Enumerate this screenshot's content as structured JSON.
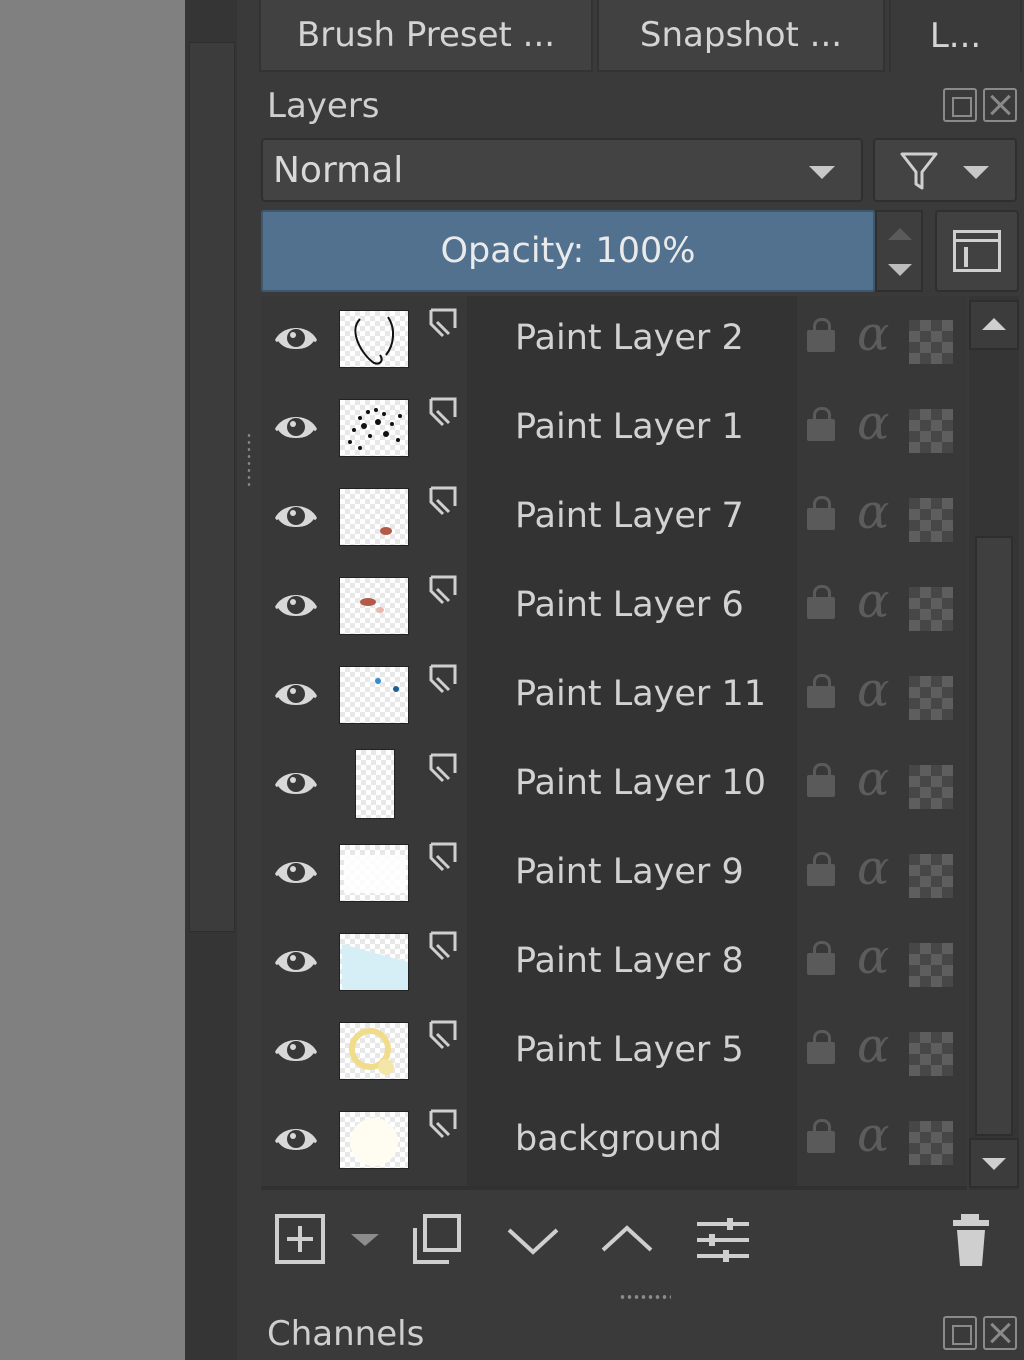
{
  "tabs": [
    {
      "label": "Brush Preset ..."
    },
    {
      "label": "Snapshot ..."
    },
    {
      "label": "L..."
    }
  ],
  "layers_docker": {
    "title": "Layers",
    "blend_mode": "Normal",
    "opacity_label": "Opacity:  100%"
  },
  "layers": [
    {
      "name": "Paint Layer 2"
    },
    {
      "name": "Paint Layer 1"
    },
    {
      "name": "Paint Layer 7"
    },
    {
      "name": "Paint Layer 6"
    },
    {
      "name": "Paint Layer 11"
    },
    {
      "name": "Paint Layer 10"
    },
    {
      "name": "Paint Layer 9"
    },
    {
      "name": "Paint Layer 8"
    },
    {
      "name": "Paint Layer 5"
    },
    {
      "name": "background"
    }
  ],
  "icons": {
    "visibility": "eye-icon",
    "clone": "clone-layer-icon",
    "lock": "lock-icon",
    "alpha": "alpha-lock-icon",
    "inherit_alpha": "checker-icon"
  },
  "alpha_glyph": "α",
  "channels_docker": {
    "title": "Channels"
  },
  "colors": {
    "accent_opacity": "#51718f",
    "panel_bg": "#3a3a3a",
    "canvas_bg": "#808080"
  }
}
